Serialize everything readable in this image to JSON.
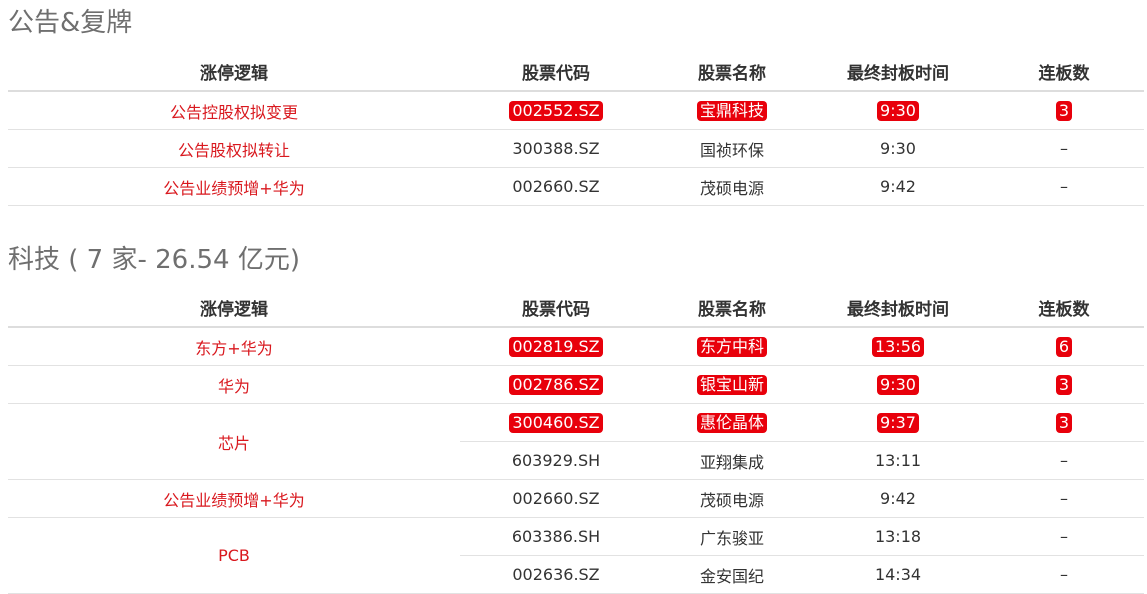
{
  "colors": {
    "highlight_bg": "#e8000b",
    "logic_text": "#d9181e",
    "title_text": "#6f6f6f"
  },
  "sections": [
    {
      "title": "公告&复牌",
      "headers": [
        "涨停逻辑",
        "股票代码",
        "股票名称",
        "最终封板时间",
        "连板数"
      ],
      "rows": [
        {
          "logic": "公告控股权拟变更",
          "code": "002552.SZ",
          "name": "宝鼎科技",
          "time": "9:30",
          "boards": "3",
          "highlight": true
        },
        {
          "logic": "公告股权拟转让",
          "code": "300388.SZ",
          "name": "国祯环保",
          "time": "9:30",
          "boards": "–",
          "highlight": false
        },
        {
          "logic": "公告业绩预增+华为",
          "code": "002660.SZ",
          "name": "茂硕电源",
          "time": "9:42",
          "boards": "–",
          "highlight": false
        }
      ]
    },
    {
      "title": "科技 ( 7 家- 26.54 亿元)",
      "headers": [
        "涨停逻辑",
        "股票代码",
        "股票名称",
        "最终封板时间",
        "连板数"
      ],
      "rows": [
        {
          "logic": "东方+华为",
          "code": "002819.SZ",
          "name": "东方中科",
          "time": "13:56",
          "boards": "6",
          "highlight": true
        },
        {
          "logic": "华为",
          "code": "002786.SZ",
          "name": "银宝山新",
          "time": "9:30",
          "boards": "3",
          "highlight": true
        },
        {
          "logic": "芯片",
          "code": "300460.SZ",
          "name": "惠伦晶体",
          "time": "9:37",
          "boards": "3",
          "highlight": true
        },
        {
          "logic": "",
          "code": "603929.SH",
          "name": "亚翔集成",
          "time": "13:11",
          "boards": "–",
          "highlight": false
        },
        {
          "logic": "公告业绩预增+华为",
          "code": "002660.SZ",
          "name": "茂硕电源",
          "time": "9:42",
          "boards": "–",
          "highlight": false
        },
        {
          "logic": "PCB",
          "code": "603386.SH",
          "name": "广东骏亚",
          "time": "13:18",
          "boards": "–",
          "highlight": false
        },
        {
          "logic": "",
          "code": "002636.SZ",
          "name": "金安国纪",
          "time": "14:34",
          "boards": "–",
          "highlight": false
        }
      ]
    }
  ]
}
